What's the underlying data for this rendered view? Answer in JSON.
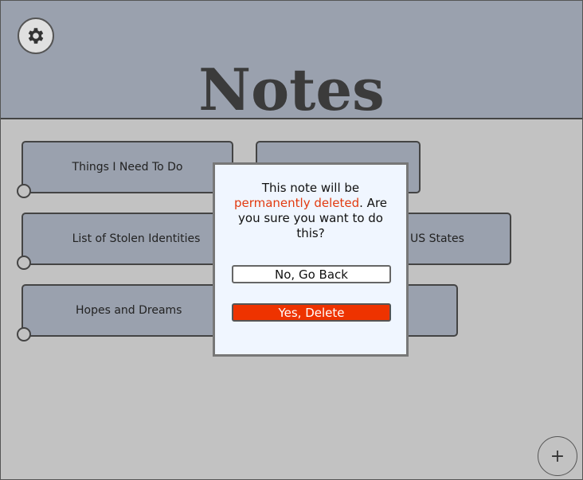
{
  "header": {
    "title": "Notes",
    "settings_icon": "gear-icon"
  },
  "notes": [
    {
      "label": "Things I Need To Do"
    },
    {
      "label": ""
    },
    {
      "label": "List of Stolen Identities"
    },
    {
      "label": "US States"
    },
    {
      "label": "Hopes and Dreams"
    },
    {
      "label": ""
    }
  ],
  "add_button": {
    "label": "+"
  },
  "dialog": {
    "message_before": "This note will be ",
    "message_danger": "permanently deleted",
    "message_after": ". Are you sure you want to do this?",
    "cancel_label": "No, Go Back",
    "confirm_label": "Yes, Delete",
    "danger_color": "#e23a10"
  }
}
